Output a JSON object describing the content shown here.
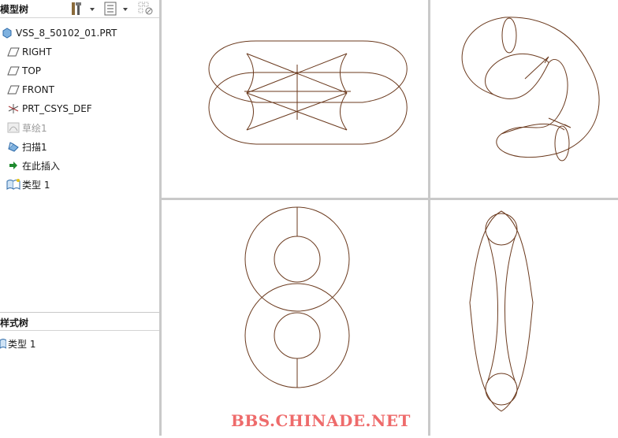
{
  "model_tree": {
    "title": "模型树",
    "toolbar": [
      "tools-icon",
      "dropdown-arrow-icon",
      "list-settings-icon",
      "dropdown-arrow-icon",
      "filter-icon"
    ],
    "items": [
      {
        "label": "VSS_8_50102_01.PRT",
        "icon": "part-icon"
      },
      {
        "label": "RIGHT",
        "icon": "datum-plane-icon"
      },
      {
        "label": "TOP",
        "icon": "datum-plane-icon"
      },
      {
        "label": "FRONT",
        "icon": "datum-plane-icon"
      },
      {
        "label": "PRT_CSYS_DEF",
        "icon": "coordinate-system-icon"
      },
      {
        "label": "草绘1",
        "icon": "sketch-icon"
      },
      {
        "label": "扫描1",
        "icon": "sweep-icon"
      },
      {
        "label": "在此插入",
        "icon": "insert-here-arrow-icon"
      },
      {
        "label": "类型 1",
        "icon": "style-type-icon"
      }
    ]
  },
  "style_tree": {
    "title": "样式树",
    "items": [
      {
        "label": "类型 1",
        "icon": "style-type-icon"
      }
    ]
  },
  "colors": {
    "wire": "#6b3a1e",
    "watermark": "#ee6b6b",
    "divider": "#c9c9c9"
  },
  "watermark": "BBS.CHINADE.NET"
}
